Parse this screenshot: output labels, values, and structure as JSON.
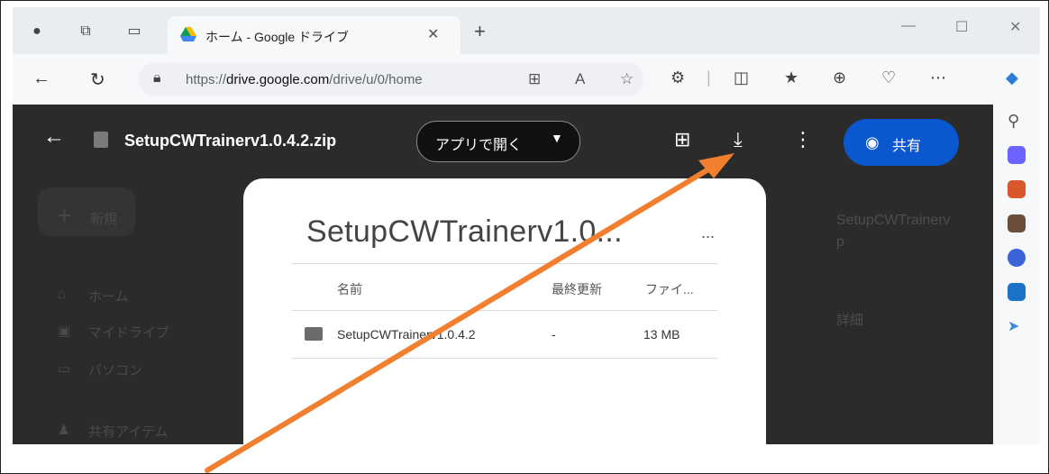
{
  "browser": {
    "tab_title": "ホーム - Google ドライブ",
    "url_prefix": "https://",
    "url_host": "drive.google.com",
    "url_path": "/drive/u/0/home"
  },
  "viewer": {
    "file_name": "SetupCWTrainerv1.0.4.2.zip",
    "open_with_label": "アプリで開く",
    "share_label": "共有",
    "background_sidebar": {
      "new_label": "新規",
      "home_label": "ホーム",
      "my_drive_label": "マイドライブ",
      "computers_label": "パソコン",
      "shared_label": "共有アイテム"
    },
    "right_panel": {
      "title_line1": "SetupCWTrainerv",
      "title_line2": "p",
      "details_label": "詳細"
    }
  },
  "zip_preview": {
    "title": "SetupCWTrainerv1.0...",
    "more": "...",
    "columns": [
      "名前",
      "最終更新",
      "ファイ..."
    ],
    "rows": [
      {
        "name": "SetupCWTrainerv1.0.4.2",
        "modified": "-",
        "size": "13 MB"
      }
    ]
  },
  "colors": {
    "accent_share": "#0b57d0",
    "annotation_arrow": "#f08030"
  }
}
